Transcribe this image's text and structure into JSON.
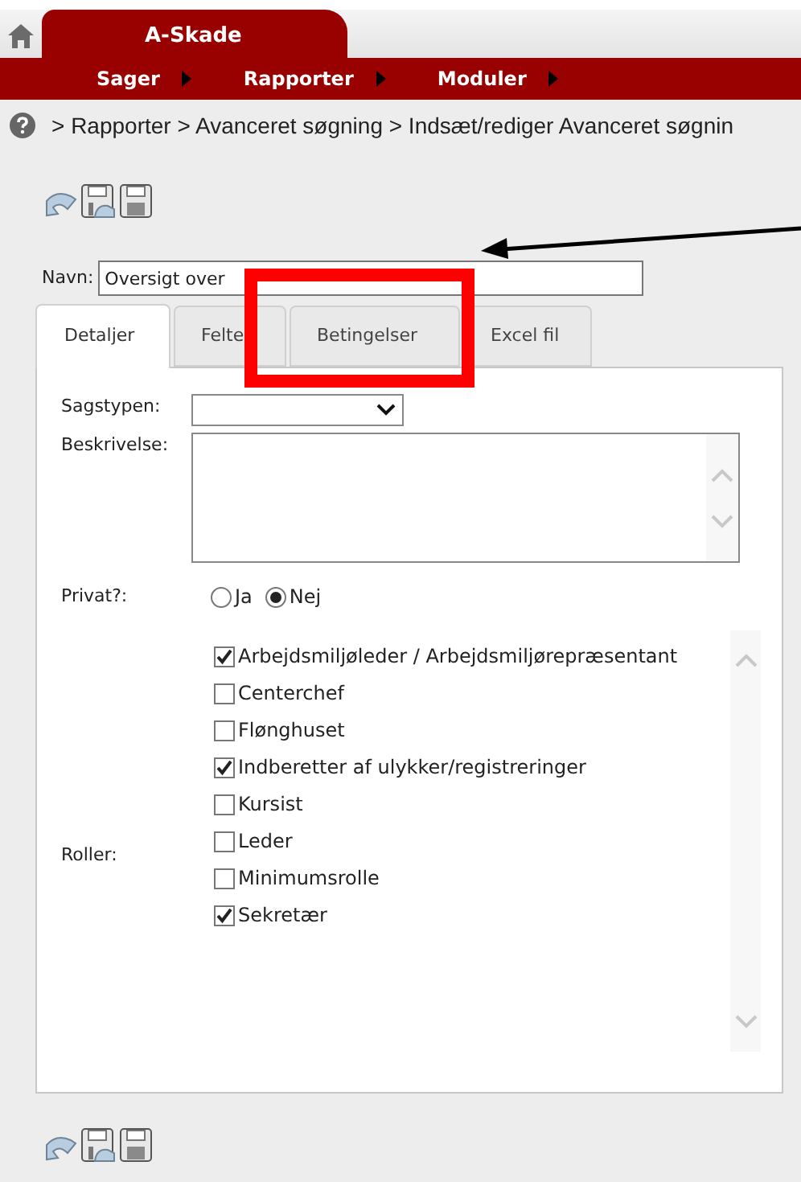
{
  "header": {
    "app_tab": "A-Skade",
    "menu": [
      {
        "label": "Sager"
      },
      {
        "label": "Rapporter"
      },
      {
        "label": "Moduler"
      }
    ]
  },
  "breadcrumb": "> Rapporter > Avanceret søgning > Indsæt/rediger Avanceret søgnin",
  "name_field": {
    "label": "Navn:",
    "value": "Oversigt over"
  },
  "tabs": [
    {
      "label": "Detaljer",
      "selected": true
    },
    {
      "label": "Felte",
      "selected": false
    },
    {
      "label": "Betingelser",
      "selected": false
    },
    {
      "label": "Excel fil",
      "selected": false
    }
  ],
  "form": {
    "sagstypen": {
      "label": "Sagstypen:"
    },
    "beskrivelse": {
      "label": "Beskrivelse:"
    },
    "privat": {
      "label": "Privat?:",
      "options": [
        {
          "label": "Ja",
          "selected": false
        },
        {
          "label": "Nej",
          "selected": true
        }
      ]
    },
    "roller": {
      "label": "Roller:",
      "items": [
        {
          "label": "Arbejdsmiljøleder / Arbejdsmiljørepræsentant",
          "checked": true
        },
        {
          "label": "Centerchef",
          "checked": false
        },
        {
          "label": "Flønghuset",
          "checked": false
        },
        {
          "label": "Indberetter af ulykker/registreringer",
          "checked": true
        },
        {
          "label": "Kursist",
          "checked": false
        },
        {
          "label": "Leder",
          "checked": false
        },
        {
          "label": "Minimumsrolle",
          "checked": false
        },
        {
          "label": "Sekretær",
          "checked": true
        }
      ]
    }
  }
}
